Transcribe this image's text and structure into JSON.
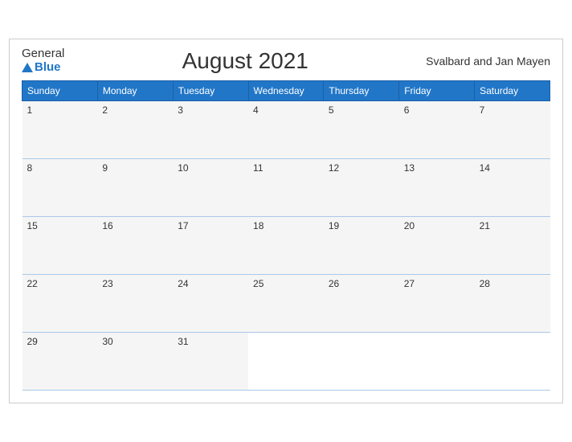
{
  "header": {
    "logo_general": "General",
    "logo_blue": "Blue",
    "title": "August 2021",
    "region": "Svalbard and Jan Mayen"
  },
  "weekdays": [
    "Sunday",
    "Monday",
    "Tuesday",
    "Wednesday",
    "Thursday",
    "Friday",
    "Saturday"
  ],
  "weeks": [
    [
      1,
      2,
      3,
      4,
      5,
      6,
      7
    ],
    [
      8,
      9,
      10,
      11,
      12,
      13,
      14
    ],
    [
      15,
      16,
      17,
      18,
      19,
      20,
      21
    ],
    [
      22,
      23,
      24,
      25,
      26,
      27,
      28
    ],
    [
      29,
      30,
      31,
      null,
      null,
      null,
      null
    ]
  ]
}
